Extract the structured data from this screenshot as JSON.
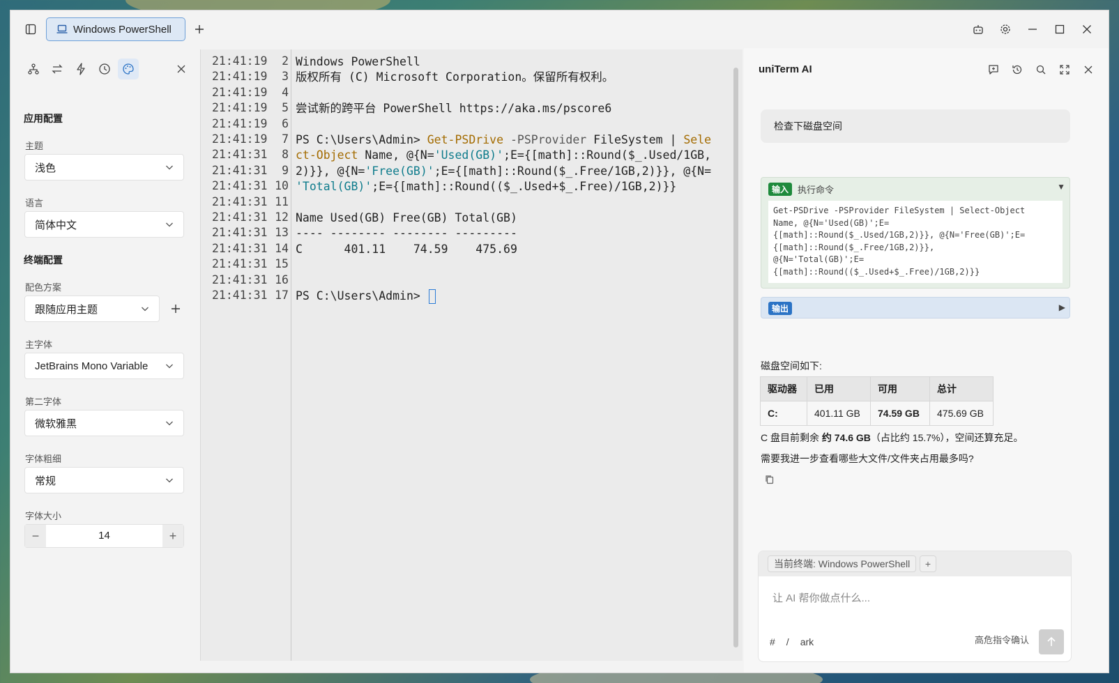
{
  "tab": {
    "title": "Windows PowerShell",
    "icon": "laptop-icon"
  },
  "left_panel": {
    "app_section": "应用配置",
    "theme_label": "主题",
    "theme_value": "浅色",
    "language_label": "语言",
    "language_value": "简体中文",
    "terminal_section": "终端配置",
    "scheme_label": "配色方案",
    "scheme_value": "跟随应用主题",
    "font_label": "主字体",
    "font_value": "JetBrains Mono Variable",
    "font2_label": "第二字体",
    "font2_value": "微软雅黑",
    "weight_label": "字体粗细",
    "weight_value": "常规",
    "size_label": "字体大小",
    "size_value": "14",
    "size_minus": "−",
    "size_plus": "+"
  },
  "terminal": {
    "gutter": [
      {
        "time": "21:41:19",
        "num": "2"
      },
      {
        "time": "21:41:19",
        "num": "3"
      },
      {
        "time": "21:41:19",
        "num": "4"
      },
      {
        "time": "21:41:19",
        "num": "5"
      },
      {
        "time": "21:41:19",
        "num": "6"
      },
      {
        "time": "21:41:19",
        "num": "7"
      },
      {
        "time": "21:41:31",
        "num": "8"
      },
      {
        "time": "21:41:31",
        "num": "9"
      },
      {
        "time": "21:41:31",
        "num": "10"
      },
      {
        "time": "21:41:31",
        "num": "11"
      },
      {
        "time": "21:41:31",
        "num": "12"
      },
      {
        "time": "21:41:31",
        "num": "13"
      },
      {
        "time": "21:41:31",
        "num": "14"
      },
      {
        "time": "21:41:31",
        "num": "15"
      },
      {
        "time": "21:41:31",
        "num": "16"
      },
      {
        "time": "21:41:31",
        "num": "17"
      }
    ],
    "line1": "Windows PowerShell",
    "line2": "版权所有 (C) Microsoft Corporation。保留所有权利。",
    "line4": "尝试新的跨平台 PowerShell https://aka.ms/pscore6",
    "cmd_prompt": "PS C:\\Users\\Admin> ",
    "cmd_name": "Get-PSDrive",
    "cmd_param": " -PSProvider",
    "cmd_arg": " FileSystem | ",
    "cmd_sel1": "Sele",
    "cmd_sel2": "ct-Object",
    "cmd_l2_rest": " Name, @{N=",
    "cmd_used": "'Used(GB)'",
    "cmd_l2_expr": ";E={[math]::Round($_.Used/1GB,",
    "cmd_l3a": "2)}}, @{N=",
    "cmd_free": "'Free(GB)'",
    "cmd_l3b": ";E={[math]::Round($_.Free/1GB,2)}}, @{N=",
    "cmd_total": "'Total(GB)'",
    "cmd_l4b": ";E={[math]::Round(($_.Used+$_.Free)/1GB,2)}}",
    "out_header": "Name Used(GB) Free(GB) Total(GB)",
    "out_rule": "---- -------- -------- ---------",
    "out_row": "C      401.11    74.59    475.69",
    "final_prompt": "PS C:\\Users\\Admin> "
  },
  "ai": {
    "title": "uniTerm AI",
    "user_message": "检查下磁盘空间",
    "tool_in_badge": "输入",
    "tool_in_label": "执行命令",
    "tool_code": "Get-PSDrive -PSProvider FileSystem | Select-Object\nName, @{N='Used(GB)';E=\n{[math]::Round($_.Used/1GB,2)}}, @{N='Free(GB)';E=\n{[math]::Round($_.Free/1GB,2)}},\n@{N='Total(GB)';E=\n{[math]::Round(($_.Used+$_.Free)/1GB,2)}}",
    "tool_out_badge": "输出",
    "answer_intro": "磁盘空间如下:",
    "table": {
      "headers": [
        "驱动器",
        "已用",
        "可用",
        "总计"
      ],
      "row": [
        "C:",
        "401.11 GB",
        "74.59 GB",
        "475.69 GB"
      ]
    },
    "summary_a": "C 盘目前剩余 ",
    "summary_b": "约 74.6 GB",
    "summary_c": "（占比约 15.7%），空间还算充足。",
    "followup": "需要我进一步查看哪些大文件/文件夹占用最多吗?",
    "context_chip": "当前终端: Windows PowerShell",
    "context_add": "+",
    "input_placeholder": "让 AI 帮你做点什么...",
    "hash": "#",
    "slash": "/",
    "model": "ark",
    "risk_confirm": "高危指令确认"
  }
}
